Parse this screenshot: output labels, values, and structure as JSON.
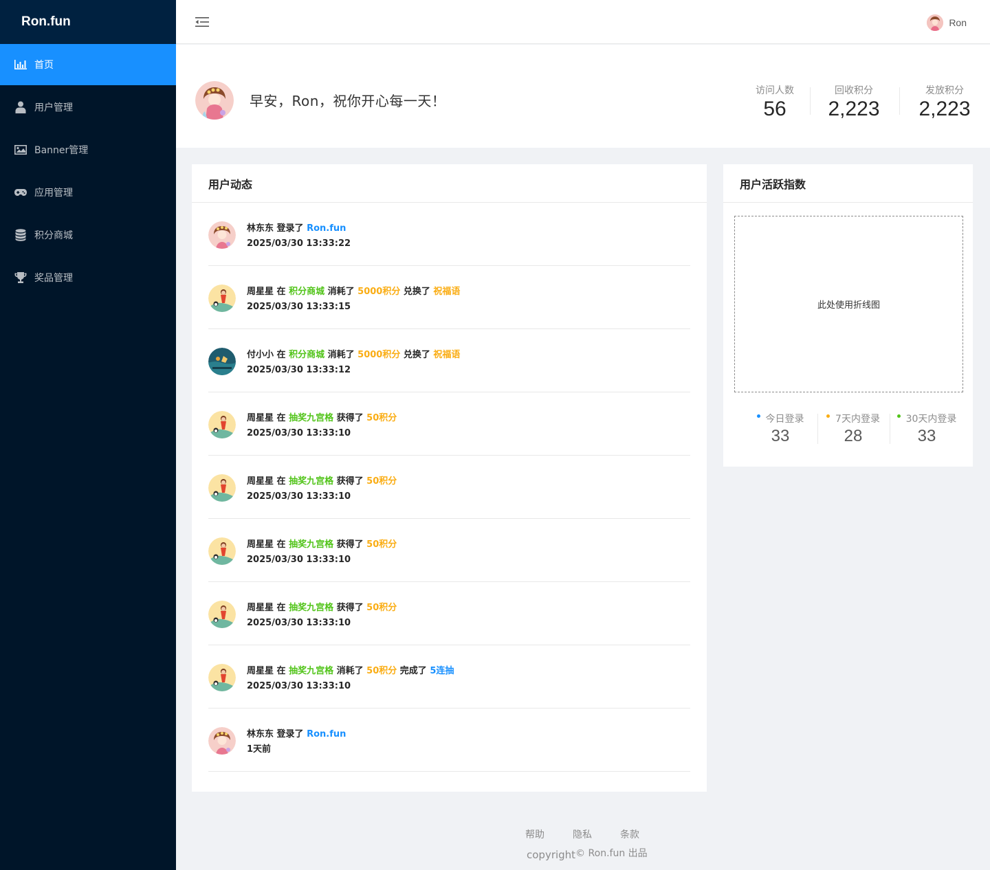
{
  "app": {
    "logo": "Ron.fun"
  },
  "sidebar": {
    "items": [
      {
        "label": "首页",
        "icon": "bar-chart-icon",
        "active": true
      },
      {
        "label": "用户管理",
        "icon": "user-icon",
        "active": false
      },
      {
        "label": "Banner管理",
        "icon": "image-icon",
        "active": false
      },
      {
        "label": "应用管理",
        "icon": "gamepad-icon",
        "active": false
      },
      {
        "label": "积分商城",
        "icon": "database-icon",
        "active": false
      },
      {
        "label": "奖品管理",
        "icon": "trophy-icon",
        "active": false
      }
    ]
  },
  "header": {
    "collapse_icon": "menu-fold-icon",
    "user_name": "Ron"
  },
  "welcome": {
    "greeting": "早安，Ron，祝你开心每一天！",
    "stats": [
      {
        "label": "访问人数",
        "value": "56"
      },
      {
        "label": "回收积分",
        "value": "2,223"
      },
      {
        "label": "发放积分",
        "value": "2,223"
      }
    ]
  },
  "activity": {
    "title": "用户动态",
    "items": [
      {
        "avatar": "pink",
        "user": "林东东",
        "parts": [
          {
            "t": " 登录了 "
          },
          {
            "t": "Ron.fun",
            "c": "blue"
          }
        ],
        "time": "2025/03/30 13:33:22"
      },
      {
        "avatar": "yellow",
        "user": "周星星",
        "parts": [
          {
            "t": " 在 "
          },
          {
            "t": "积分商城",
            "c": "green"
          },
          {
            "t": " 消耗了 "
          },
          {
            "t": "5000积分",
            "c": "gold"
          },
          {
            "t": " 兑换了 "
          },
          {
            "t": "祝福语",
            "c": "gold"
          }
        ],
        "time": "2025/03/30 13:33:15"
      },
      {
        "avatar": "teal",
        "user": "付小小",
        "parts": [
          {
            "t": " 在 "
          },
          {
            "t": "积分商城",
            "c": "green"
          },
          {
            "t": " 消耗了 "
          },
          {
            "t": "5000积分",
            "c": "gold"
          },
          {
            "t": " 兑换了 "
          },
          {
            "t": "祝福语",
            "c": "gold"
          }
        ],
        "time": "2025/03/30 13:33:12"
      },
      {
        "avatar": "yellow",
        "user": "周星星",
        "parts": [
          {
            "t": " 在 "
          },
          {
            "t": "抽奖九宫格",
            "c": "green"
          },
          {
            "t": " 获得了 "
          },
          {
            "t": "50积分",
            "c": "gold"
          }
        ],
        "time": "2025/03/30 13:33:10"
      },
      {
        "avatar": "yellow",
        "user": "周星星",
        "parts": [
          {
            "t": " 在 "
          },
          {
            "t": "抽奖九宫格",
            "c": "green"
          },
          {
            "t": " 获得了 "
          },
          {
            "t": "50积分",
            "c": "gold"
          }
        ],
        "time": "2025/03/30 13:33:10"
      },
      {
        "avatar": "yellow",
        "user": "周星星",
        "parts": [
          {
            "t": " 在 "
          },
          {
            "t": "抽奖九宫格",
            "c": "green"
          },
          {
            "t": " 获得了 "
          },
          {
            "t": "50积分",
            "c": "gold"
          }
        ],
        "time": "2025/03/30 13:33:10"
      },
      {
        "avatar": "yellow",
        "user": "周星星",
        "parts": [
          {
            "t": " 在 "
          },
          {
            "t": "抽奖九宫格",
            "c": "green"
          },
          {
            "t": " 获得了 "
          },
          {
            "t": "50积分",
            "c": "gold"
          }
        ],
        "time": "2025/03/30 13:33:10"
      },
      {
        "avatar": "yellow",
        "user": "周星星",
        "parts": [
          {
            "t": " 在 "
          },
          {
            "t": "抽奖九宫格",
            "c": "green"
          },
          {
            "t": " 消耗了 "
          },
          {
            "t": "50积分",
            "c": "gold"
          },
          {
            "t": " 完成了 "
          },
          {
            "t": "5连抽",
            "c": "blue"
          }
        ],
        "time": "2025/03/30 13:33:10"
      },
      {
        "avatar": "pink",
        "user": "林东东",
        "parts": [
          {
            "t": " 登录了 "
          },
          {
            "t": "Ron.fun",
            "c": "blue"
          }
        ],
        "time": "1天前"
      }
    ]
  },
  "activity_index": {
    "title": "用户活跃指数",
    "placeholder": "此处使用折线图",
    "stats": [
      {
        "label": "今日登录",
        "value": "33",
        "dot_color": "#1890ff"
      },
      {
        "label": "7天内登录",
        "value": "28",
        "dot_color": "#faad14"
      },
      {
        "label": "30天内登录",
        "value": "33",
        "dot_color": "#52c41a"
      }
    ]
  },
  "footer": {
    "links": [
      "帮助",
      "隐私",
      "条款"
    ],
    "copyright_word": "copyright",
    "copyright_rest": "© Ron.fun 出品"
  },
  "colors": {
    "primary": "#1890ff",
    "sidebar_bg": "#001529",
    "logo_bg": "#002140",
    "green": "#52c41a",
    "gold": "#faad14"
  }
}
